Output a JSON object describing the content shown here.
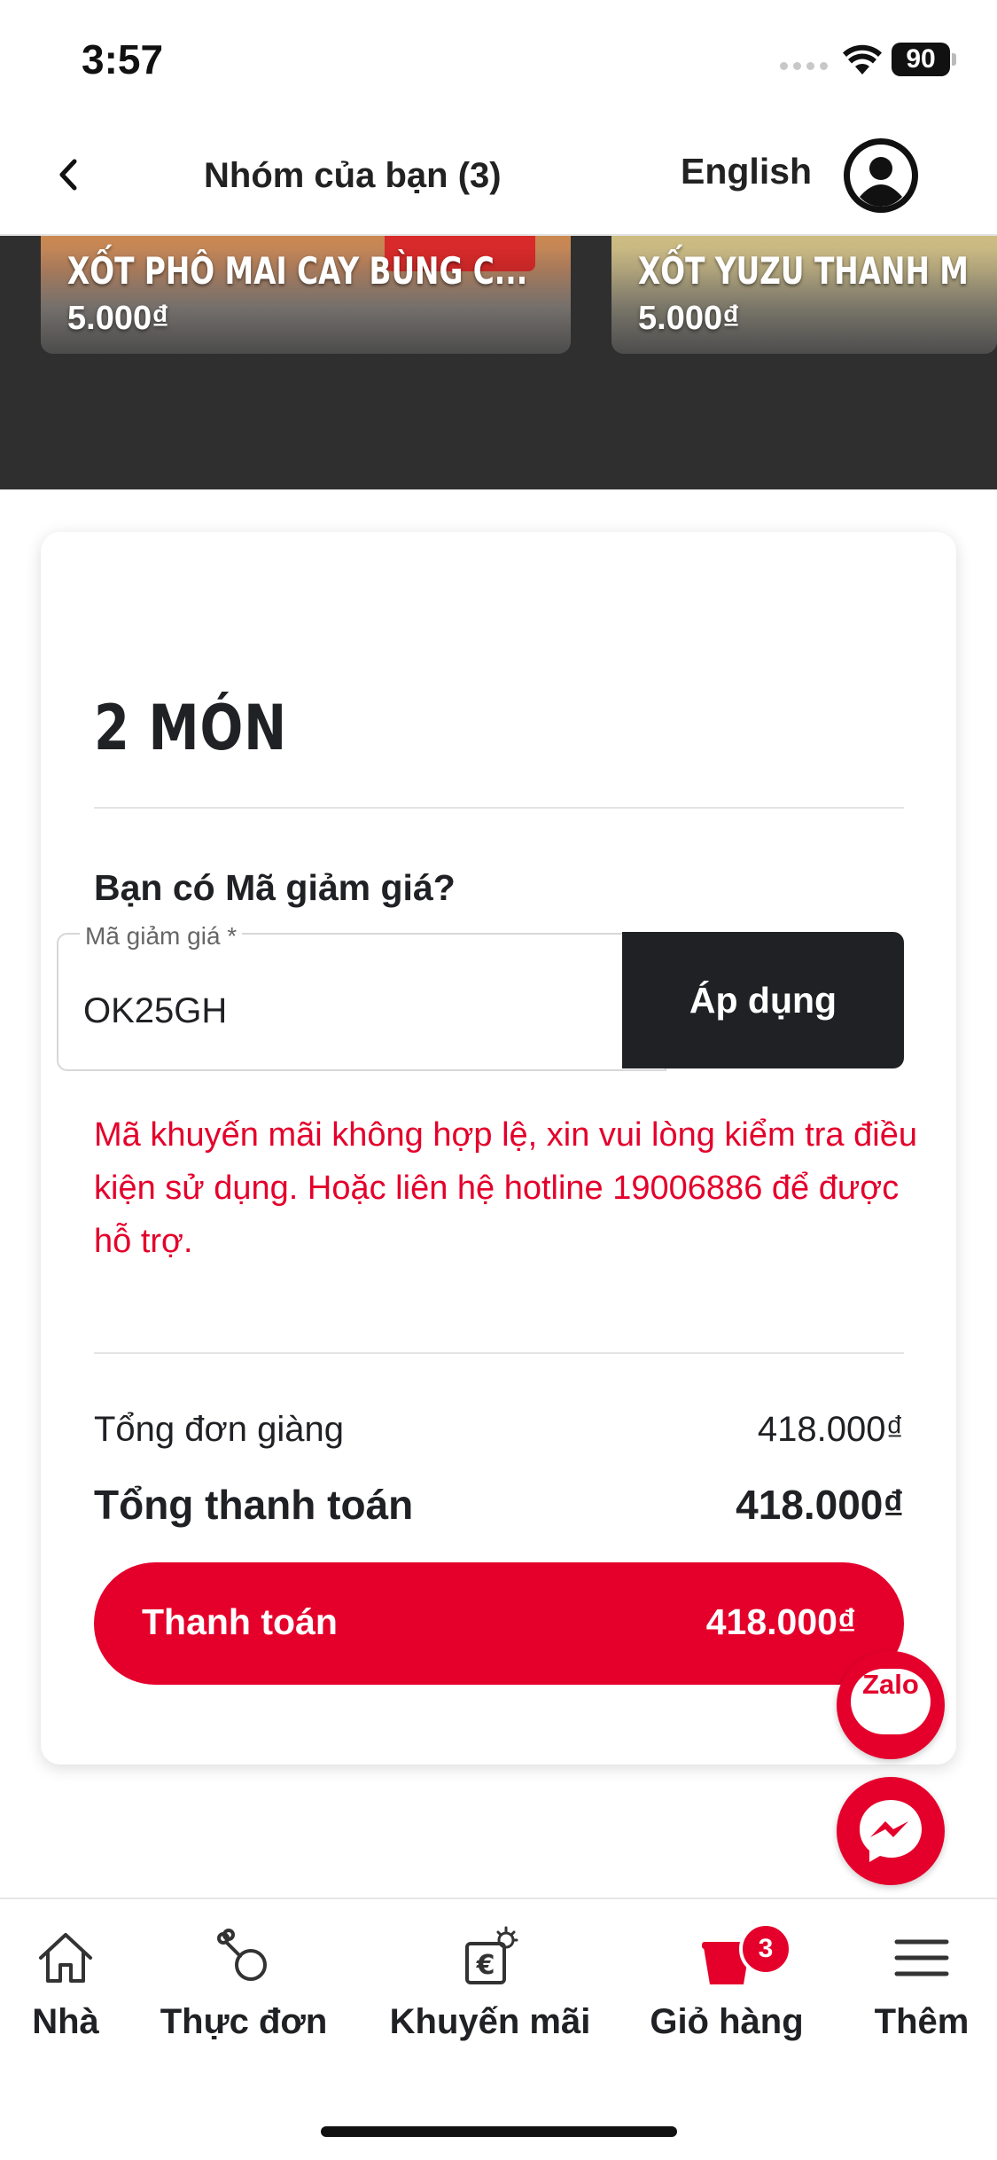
{
  "status_bar": {
    "time": "3:57",
    "battery": "90"
  },
  "header": {
    "title": "Nhóm của bạn (3)",
    "language": "English"
  },
  "products": [
    {
      "name": "XỐT PHÔ MAI CAY BÙNG C...",
      "price": "5.000₫",
      "pack_text": ""
    },
    {
      "name": "XỐT YUZU THANH M",
      "price": "5.000₫"
    }
  ],
  "summary": {
    "items_count": "2 MÓN",
    "promo_question": "Bạn có Mã giảm giá?",
    "promo_label": "Mã giảm giá *",
    "promo_value": "OK25GH",
    "apply_label": "Áp dụng",
    "error_message": "Mã khuyến mãi không hợp lệ, xin vui lòng kiểm tra điều kiện sử dụng. Hoặc liên hệ hotline 19006886 để được hỗ trợ.",
    "subtotal_label": "Tổng đơn giàng",
    "subtotal_value": "418.000₫",
    "total_label": "Tổng thanh toán",
    "total_value": "418.000₫",
    "checkout_label": "Thanh toán",
    "checkout_amount": "418.000₫"
  },
  "chat": {
    "zalo_label": "Zalo"
  },
  "bottom_nav": {
    "home": "Nhà",
    "menu": "Thực đơn",
    "promotions": "Khuyến mãi",
    "cart": "Giỏ hàng",
    "cart_count": "3",
    "more": "Thêm"
  },
  "colors": {
    "brand_red": "#e4002b",
    "dark": "#202124",
    "strip": "#2f2f2f"
  }
}
